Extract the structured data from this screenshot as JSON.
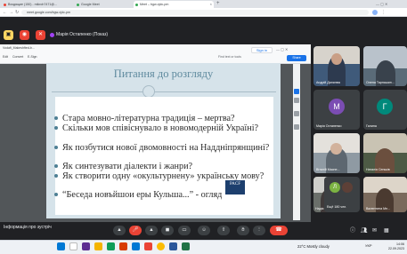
{
  "browser": {
    "tabs": [
      {
        "label": "Входящие (150) - mikroh7471@..."
      },
      {
        "label": "Google Meet"
      },
      {
        "label": "Meet – bgw-xjdc-pm"
      }
    ],
    "url": "meet.google.com/bgw-xjdc-pm"
  },
  "meet": {
    "presenter": "Марія Остапенко (Показ)",
    "meeting_info_label": "Інформація про зустріч"
  },
  "pdf": {
    "filename": "Vodafi_Makeshfted-b...",
    "toolbar_items": [
      "Edit",
      "Convert",
      "E-Sign",
      "Find text or tools"
    ],
    "signin_label": "Sign in",
    "share_label": "Share"
  },
  "slide": {
    "title": "Питання до розгляду",
    "bullets": [
      "Стара мовно-літературна традиція – мертва?",
      "Скільки мов співіснувало в новомодерній Україні?",
      "Як позбутися нової двомовності на Наддніпрянщині?",
      "Як синтезувати діалекти і жанри?",
      "Як створити одну «окультурнену» українську мову?",
      "“Беседа новъйшои еры Кульша...” - огляд"
    ],
    "logo_text": "PACF"
  },
  "participants": [
    {
      "name": "Андрій Данилюк",
      "type": "video"
    },
    {
      "name": "Олена Тарнашин...",
      "type": "video"
    },
    {
      "name": "Марія Остапенко",
      "type": "avatar",
      "initial": "М",
      "color": "#7b4db3"
    },
    {
      "name": "Галина",
      "type": "avatar",
      "initial": "Г",
      "color": "#00897b"
    },
    {
      "name": "Віталій Масне...",
      "type": "video"
    },
    {
      "name": "Наталія Сеньків",
      "type": "video"
    },
    {
      "name": "Надія Зінченко",
      "type": "video"
    },
    {
      "name": "Ещё 180 чел.",
      "type": "group"
    },
    {
      "name": "Валентина Ме...",
      "type": "video"
    }
  ],
  "taskbar": {
    "weather": "22°C  Mostly cloudy",
    "time": "14:06",
    "date": "22.09.2023",
    "lang": "УКР"
  }
}
